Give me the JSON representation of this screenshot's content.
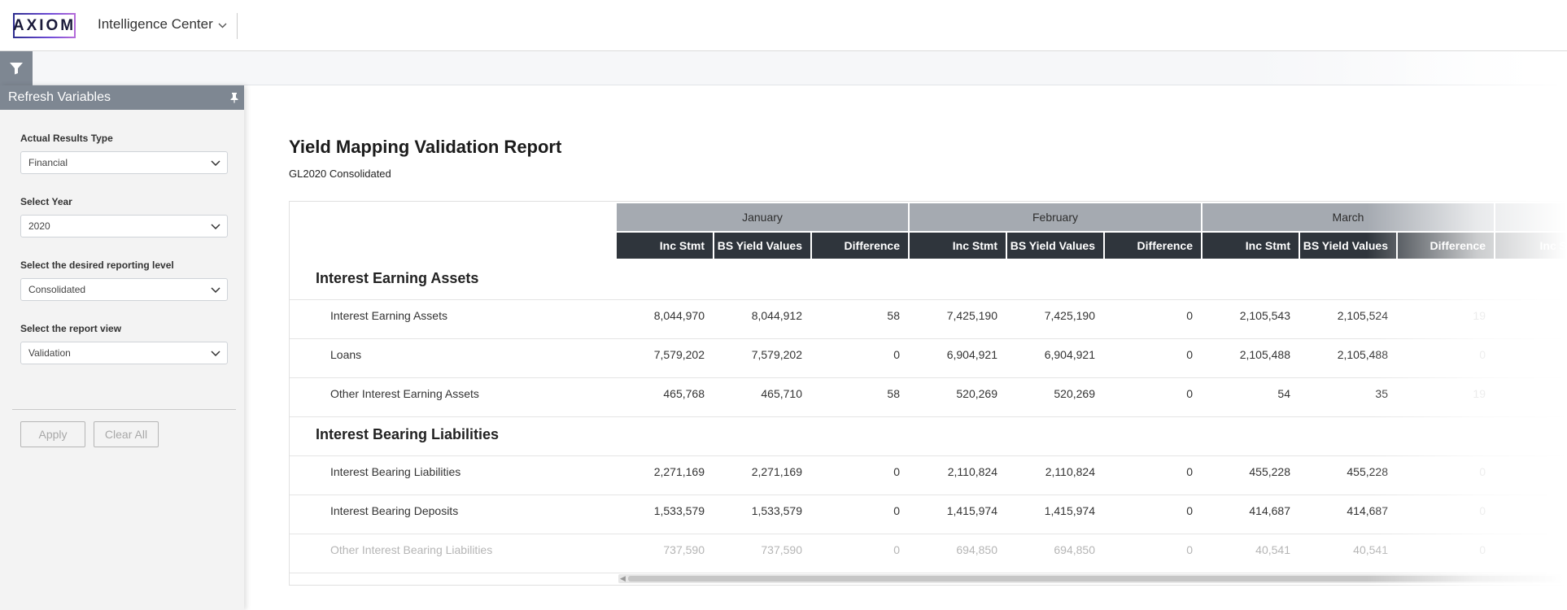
{
  "app": {
    "logo_text": "AXIOM",
    "name": "Intelligence Center"
  },
  "panel": {
    "title": "Refresh Variables",
    "fields": [
      {
        "label": "Actual Results Type",
        "value": "Financial"
      },
      {
        "label": "Select Year",
        "value": "2020"
      },
      {
        "label": "Select the desired reporting level",
        "value": "Consolidated"
      },
      {
        "label": "Select the report view",
        "value": "Validation"
      }
    ],
    "apply_label": "Apply",
    "clear_label": "Clear All"
  },
  "report": {
    "title": "Yield Mapping Validation Report",
    "subtitle": "GL2020 Consolidated",
    "months": [
      "January",
      "February",
      "March"
    ],
    "columns": [
      "Inc Stmt",
      "BS Yield Values",
      "Difference"
    ],
    "partial_column": "Inc S",
    "sections": [
      {
        "title": "Interest Earning Assets",
        "rows": [
          {
            "label": "Interest Earning Assets",
            "values": [
              "8,044,970",
              "8,044,912",
              "58",
              "7,425,190",
              "7,425,190",
              "0",
              "2,105,543",
              "2,105,524",
              "19"
            ]
          },
          {
            "label": "Loans",
            "values": [
              "7,579,202",
              "7,579,202",
              "0",
              "6,904,921",
              "6,904,921",
              "0",
              "2,105,488",
              "2,105,488",
              "0"
            ]
          },
          {
            "label": "Other Interest Earning Assets",
            "values": [
              "465,768",
              "465,710",
              "58",
              "520,269",
              "520,269",
              "0",
              "54",
              "35",
              "19"
            ]
          }
        ]
      },
      {
        "title": "Interest Bearing Liabilities",
        "rows": [
          {
            "label": "Interest Bearing Liabilities",
            "values": [
              "2,271,169",
              "2,271,169",
              "0",
              "2,110,824",
              "2,110,824",
              "0",
              "455,228",
              "455,228",
              "0"
            ]
          },
          {
            "label": "Interest Bearing Deposits",
            "values": [
              "1,533,579",
              "1,533,579",
              "0",
              "1,415,974",
              "1,415,974",
              "0",
              "414,687",
              "414,687",
              "0"
            ]
          },
          {
            "label": "Other Interest Bearing Liabilities",
            "values": [
              "737,590",
              "737,590",
              "0",
              "694,850",
              "694,850",
              "0",
              "40,541",
              "40,541",
              "0"
            ]
          }
        ]
      }
    ]
  },
  "colors": {
    "panel_header": "#7e8792",
    "month_header": "#a5aab1",
    "column_header": "#2f353c",
    "logo_gradient_start": "#2d2d8f",
    "logo_gradient_end": "#b46bd9"
  },
  "icons": {
    "filter": "filter-icon",
    "pin": "pin-icon",
    "chevron": "chevron-down-icon"
  }
}
